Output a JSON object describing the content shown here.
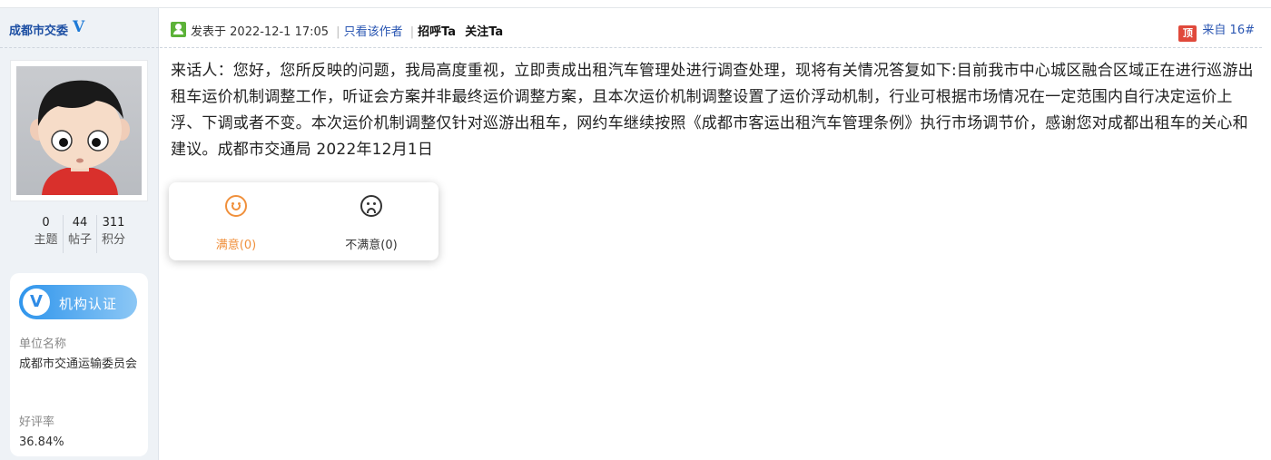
{
  "author": {
    "name": "成都市交委",
    "verified_mark": "V",
    "stats": [
      {
        "value": "0",
        "label": "主题"
      },
      {
        "value": "44",
        "label": "帖子"
      },
      {
        "value": "311",
        "label": "积分"
      }
    ],
    "certification": {
      "badge_icon": "V",
      "badge_text": "机构认证",
      "unit_label": "单位名称",
      "unit_value": "成都市交通运输委员会",
      "rating_label": "好评率",
      "rating_value": "36.84%"
    }
  },
  "post": {
    "posted_prefix": "发表于",
    "posted_time": "2022-12-1 17:05",
    "only_author_link": "只看该作者",
    "greet_link": "招呼Ta",
    "follow_link": "关注Ta",
    "from_icon": "顶",
    "from_text": "来自 16#",
    "body": "来话人：您好，您所反映的问题，我局高度重视，立即责成出租汽车管理处进行调查处理，现将有关情况答复如下:目前我市中心城区融合区域正在进行巡游出租车运价机制调整工作，听证会方案并非最终运价调整方案，且本次运价机制调整设置了运价浮动机制，行业可根据市场情况在一定范围内自行决定运价上浮、下调或者不变。本次运价机制调整仅针对巡游出租车，网约车继续按照《成都市客运出租汽车管理条例》执行市场调节价，感谢您对成都出租车的关心和建议。成都市交通局 2022年12月1日"
  },
  "rating": {
    "satisfied": "满意(0)",
    "unsatisfied": "不满意(0)"
  },
  "colors": {
    "link": "#2a56b2",
    "accent_orange": "#f0903c",
    "badge_blue": "#2f95ec",
    "sidebar_bg": "#eef2f6"
  }
}
